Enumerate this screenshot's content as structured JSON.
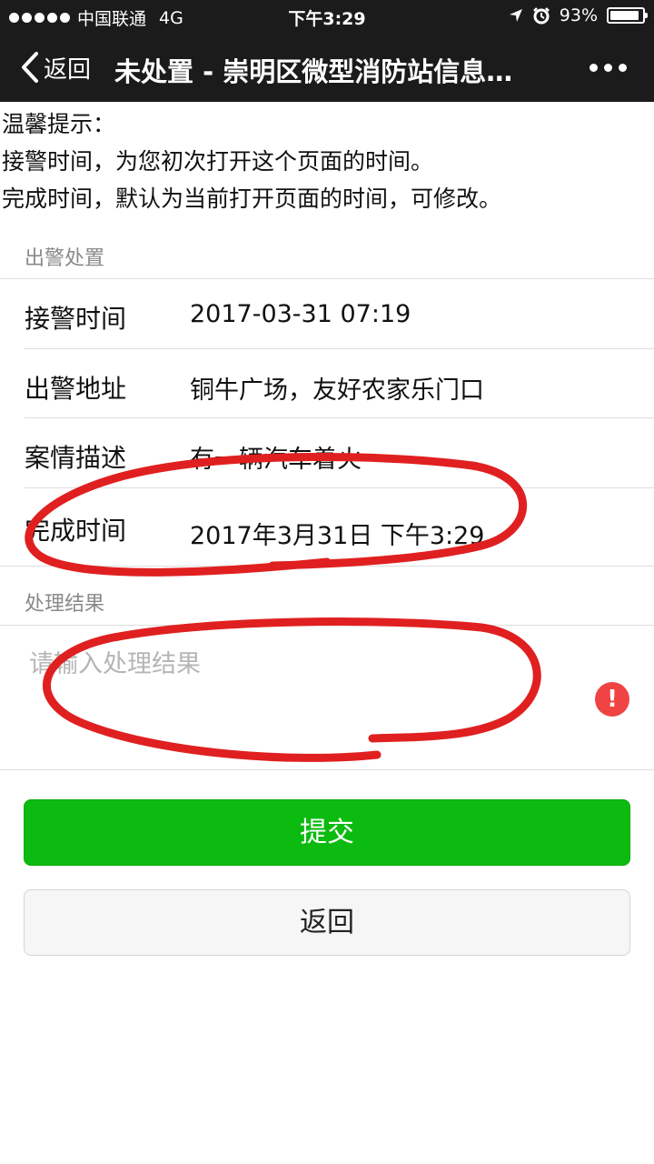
{
  "status_bar": {
    "carrier": "中国联通",
    "network": "4G",
    "time": "下午3:29",
    "battery": "93%",
    "battery_level": 0.93
  },
  "nav": {
    "back_label": "返回",
    "title": "未处置 - 崇明区微型消防站信息…"
  },
  "tips": {
    "heading": "温馨提示：",
    "line1": "接警时间，为您初次打开这个页面的时间。",
    "line2": "完成时间，默认为当前打开页面的时间，可修改。"
  },
  "dispatch": {
    "section_title": "出警处置",
    "rows": [
      {
        "label": "接警时间",
        "value": "2017-03-31 07:19"
      },
      {
        "label": "出警地址",
        "value": "铜牛广场，友好农家乐门口"
      },
      {
        "label": "案情描述",
        "value": "有一辆汽车着火"
      },
      {
        "label": "完成时间",
        "value": "2017年3月31日 下午3:29"
      }
    ]
  },
  "result": {
    "section_title": "处理结果",
    "placeholder": "请输入处理结果",
    "warning_symbol": "!"
  },
  "buttons": {
    "submit": "提交",
    "back": "返回"
  },
  "colors": {
    "nav_bg": "#1b1b1b",
    "primary": "#0cbb0f",
    "warning": "#f04343",
    "annotation": "#e02020"
  }
}
